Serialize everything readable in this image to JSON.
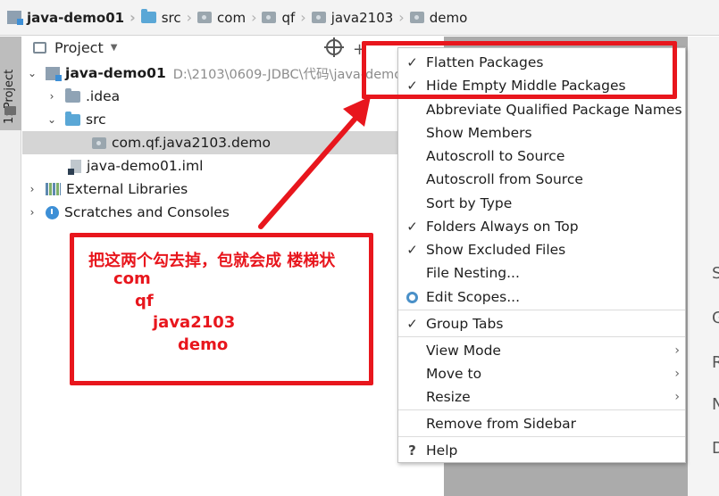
{
  "breadcrumb": [
    "java-demo01",
    "src",
    "com",
    "qf",
    "java2103",
    "demo"
  ],
  "side_tab": {
    "label": "1: Project"
  },
  "panel": {
    "title": "Project"
  },
  "tree": [
    {
      "label": "java-demo01",
      "path": "D:\\2103\\0609-JDBC\\代码\\java-demo0"
    },
    {
      "label": ".idea"
    },
    {
      "label": "src"
    },
    {
      "label": "com.qf.java2103.demo"
    },
    {
      "label": "java-demo01.iml"
    },
    {
      "label": "External Libraries"
    },
    {
      "label": "Scratches and Consoles"
    }
  ],
  "menu": {
    "items": [
      {
        "label": "Flatten Packages",
        "checked": true
      },
      {
        "label": "Hide Empty Middle Packages",
        "checked": true
      },
      {
        "label": "Abbreviate Qualified Package Names",
        "checked": false
      },
      {
        "label": "Show Members",
        "checked": false
      },
      {
        "label": "Autoscroll to Source",
        "checked": false
      },
      {
        "label": "Autoscroll from Source",
        "checked": false
      },
      {
        "label": "Sort by Type",
        "checked": false
      },
      {
        "label": "Folders Always on Top",
        "checked": true
      },
      {
        "label": "Show Excluded Files",
        "checked": true
      },
      {
        "label": "File Nesting...",
        "checked": false
      },
      {
        "label": "Edit Scopes...",
        "checked": false
      },
      {
        "label": "Group Tabs",
        "checked": true
      },
      {
        "label": "View Mode",
        "submenu": true
      },
      {
        "label": "Move to",
        "submenu": true
      },
      {
        "label": "Resize",
        "submenu": true
      },
      {
        "label": "Remove from Sidebar"
      },
      {
        "label": "Help"
      }
    ]
  },
  "annotation": {
    "lines": [
      "把这两个勾去掉，包就会成 楼梯状",
      "com",
      "qf",
      "java2103",
      "demo"
    ],
    "color": "#e8161d"
  },
  "right_edge_letters": [
    "S",
    "G",
    "R",
    "N",
    "D"
  ]
}
